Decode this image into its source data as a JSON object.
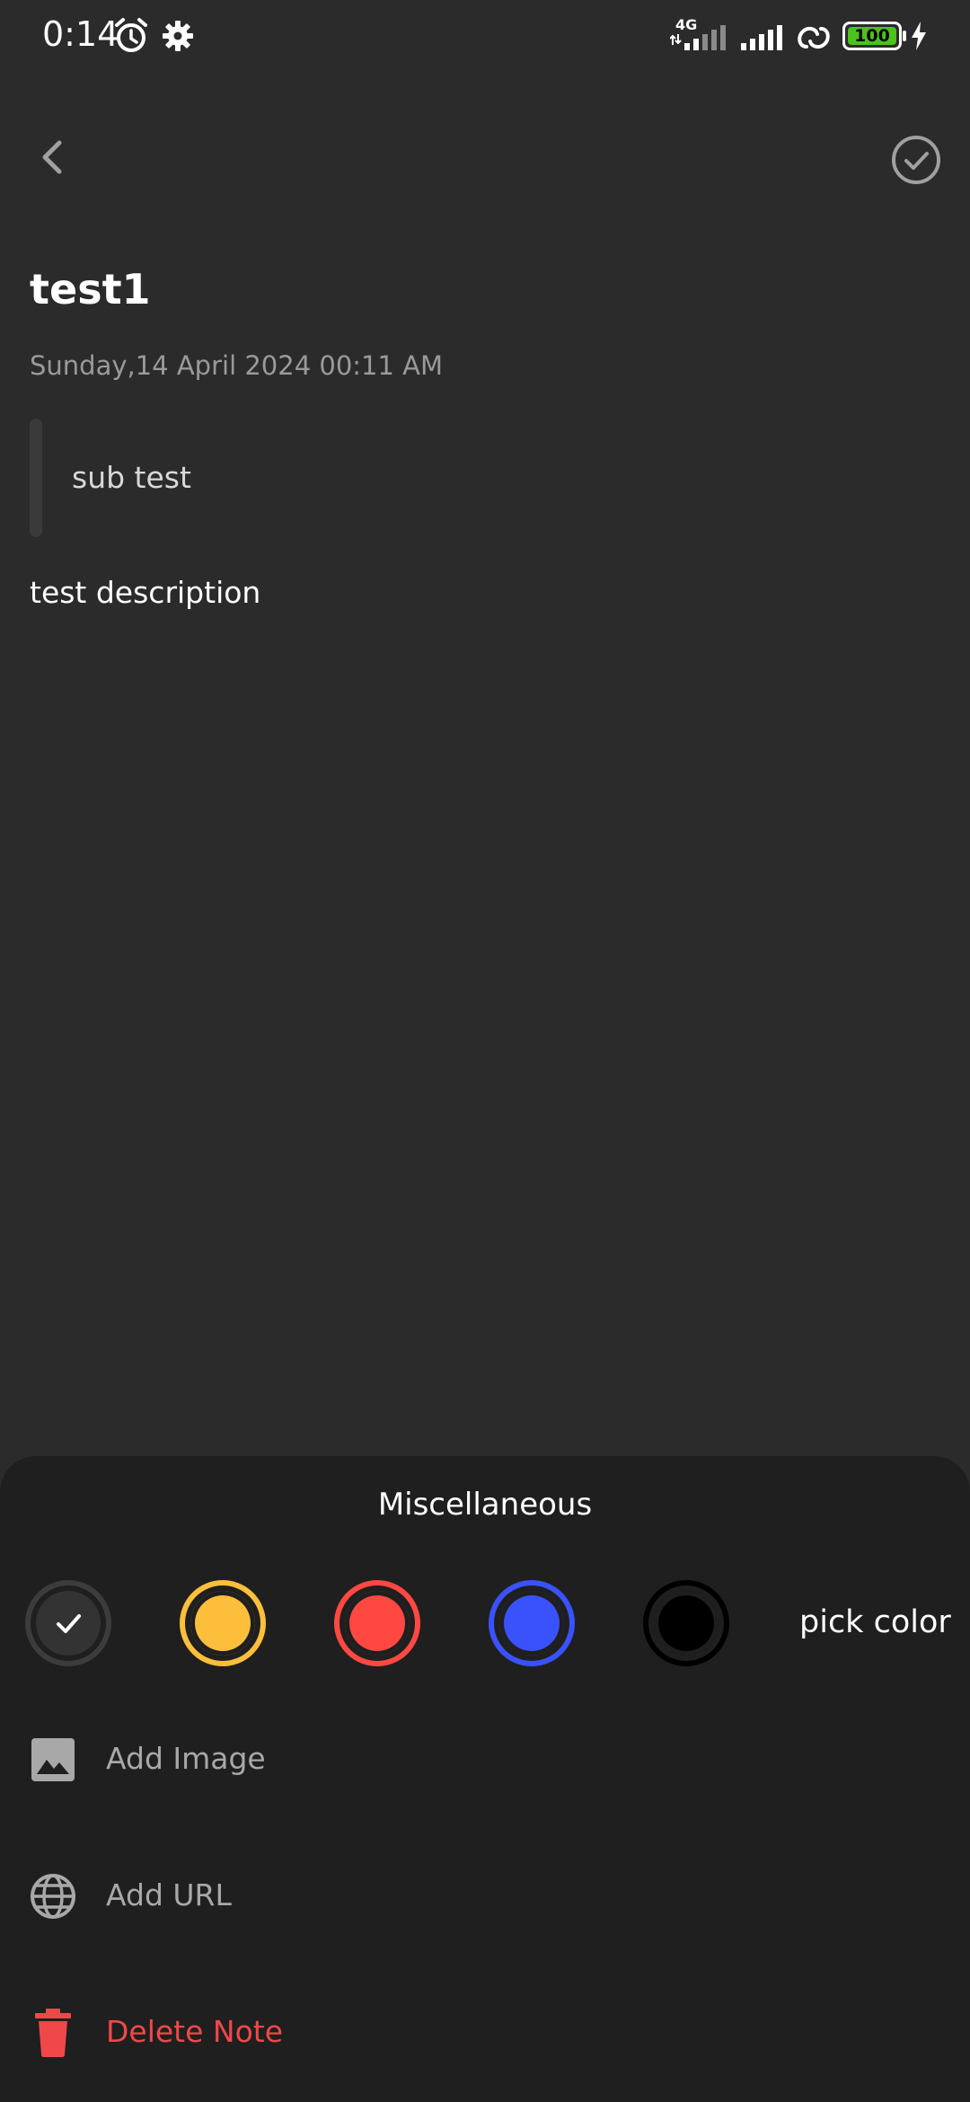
{
  "status_bar": {
    "time": "0:14",
    "network_label": "4G",
    "battery": "100"
  },
  "toolbar": {
    "back_icon": "chevron-left-icon",
    "save_icon": "check-circle-icon"
  },
  "note": {
    "title": "test1",
    "date": "Sunday,14 April 2024 00:11 AM",
    "subtitle": "sub test",
    "body": "test description"
  },
  "sheet": {
    "title": "Miscellaneous",
    "colors": [
      {
        "name": "default",
        "hex": "#333333",
        "ring": "#3c3c3c",
        "selected": true
      },
      {
        "name": "yellow",
        "hex": "#fdbe3b",
        "ring": "#fdbe3b",
        "selected": false
      },
      {
        "name": "red",
        "hex": "#ff4842",
        "ring": "#ff4842",
        "selected": false
      },
      {
        "name": "blue",
        "hex": "#3a52fc",
        "ring": "#3a52fc",
        "selected": false
      },
      {
        "name": "black",
        "hex": "#000000",
        "ring": "#000000",
        "selected": false
      }
    ],
    "pick_color_label": "pick color",
    "menu": [
      {
        "label": "Add Image",
        "icon": "image-icon"
      },
      {
        "label": "Add URL",
        "icon": "globe-icon"
      },
      {
        "label": "Delete Note",
        "icon": "trash-icon",
        "danger": true
      }
    ]
  },
  "colors": {
    "background": "#2b2b2b",
    "sheet": "#1f1f1f",
    "danger": "#f04848",
    "battery_fill": "#4cc21d"
  }
}
